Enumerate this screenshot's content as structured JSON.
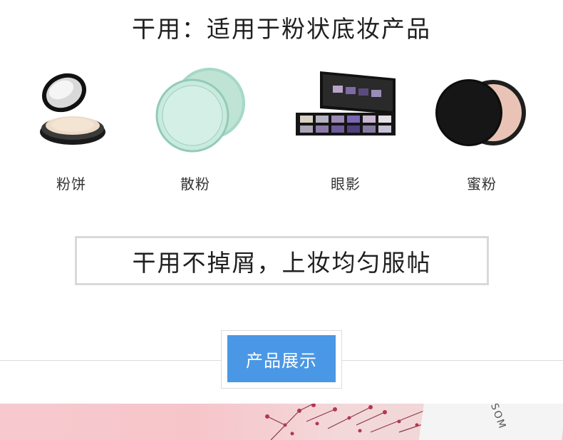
{
  "headline": "干用：适用于粉状底妆产品",
  "products": [
    {
      "label": "粉饼",
      "icon": "compact-powder-icon"
    },
    {
      "label": "散粉",
      "icon": "loose-powder-icon"
    },
    {
      "label": "眼影",
      "icon": "eyeshadow-palette-icon"
    },
    {
      "label": "蜜粉",
      "icon": "pressed-powder-icon"
    }
  ],
  "tagline": "干用不掉屑，上妆均匀服帖",
  "section_button": "产品展示",
  "banner": {
    "text": "SOM"
  },
  "colors": {
    "accent": "#4a97e5",
    "banner_pink": "#f7c9ce",
    "border": "#d9d9d9"
  }
}
